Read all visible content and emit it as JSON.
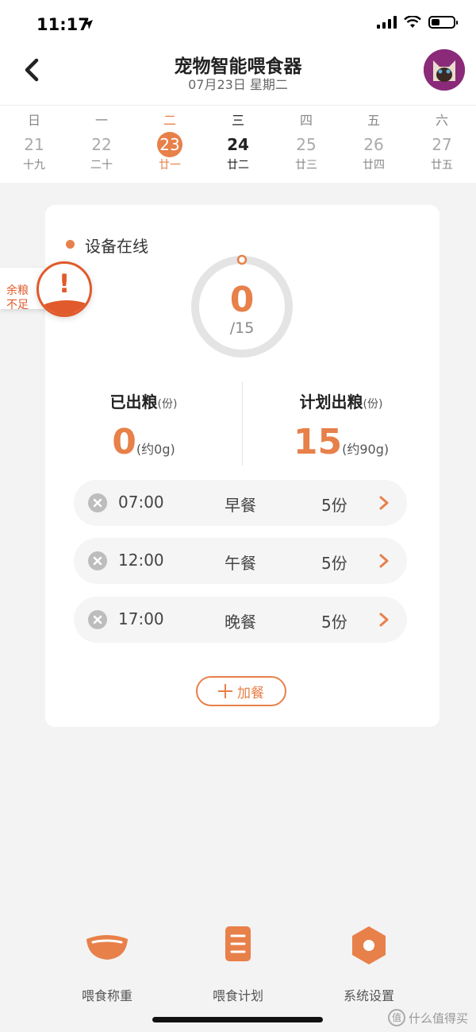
{
  "status_bar": {
    "time": "11:17"
  },
  "header": {
    "title": "宠物智能喂食器",
    "date": "07月23日 星期二"
  },
  "calendar": [
    {
      "week": "日",
      "day": "21",
      "lunar": "十九"
    },
    {
      "week": "一",
      "day": "22",
      "lunar": "二十"
    },
    {
      "week": "二",
      "day": "23",
      "lunar": "廿一",
      "state": "selected"
    },
    {
      "week": "三",
      "day": "24",
      "lunar": "廿二",
      "state": "today"
    },
    {
      "week": "四",
      "day": "25",
      "lunar": "廿三"
    },
    {
      "week": "五",
      "day": "26",
      "lunar": "廿四"
    },
    {
      "week": "六",
      "day": "27",
      "lunar": "廿五"
    }
  ],
  "low_food": {
    "text": "余粮不足",
    "mark": "!"
  },
  "device": {
    "status": "设备在线",
    "dispensed": "0",
    "planned_total": "/15",
    "progress_fraction": 0
  },
  "stats": {
    "dispensed": {
      "title": "已出粮",
      "unit": "(份)",
      "value": "0",
      "approx": "(约0g)"
    },
    "planned": {
      "title": "计划出粮",
      "unit": "(份)",
      "value": "15",
      "approx": "(约90g)"
    }
  },
  "meals": [
    {
      "time": "07:00",
      "name": "早餐",
      "portion": "5份"
    },
    {
      "time": "12:00",
      "name": "午餐",
      "portion": "5份"
    },
    {
      "time": "17:00",
      "name": "晚餐",
      "portion": "5份"
    }
  ],
  "add_meal_label": "加餐",
  "nav": [
    {
      "label": "喂食称重",
      "icon": "bowl-icon"
    },
    {
      "label": "喂食计划",
      "icon": "plan-list-icon"
    },
    {
      "label": "系统设置",
      "icon": "settings-hexagon-icon"
    }
  ],
  "watermark": "什么值得买",
  "colors": {
    "accent": "#e8804a",
    "alert": "#e05a2b"
  }
}
